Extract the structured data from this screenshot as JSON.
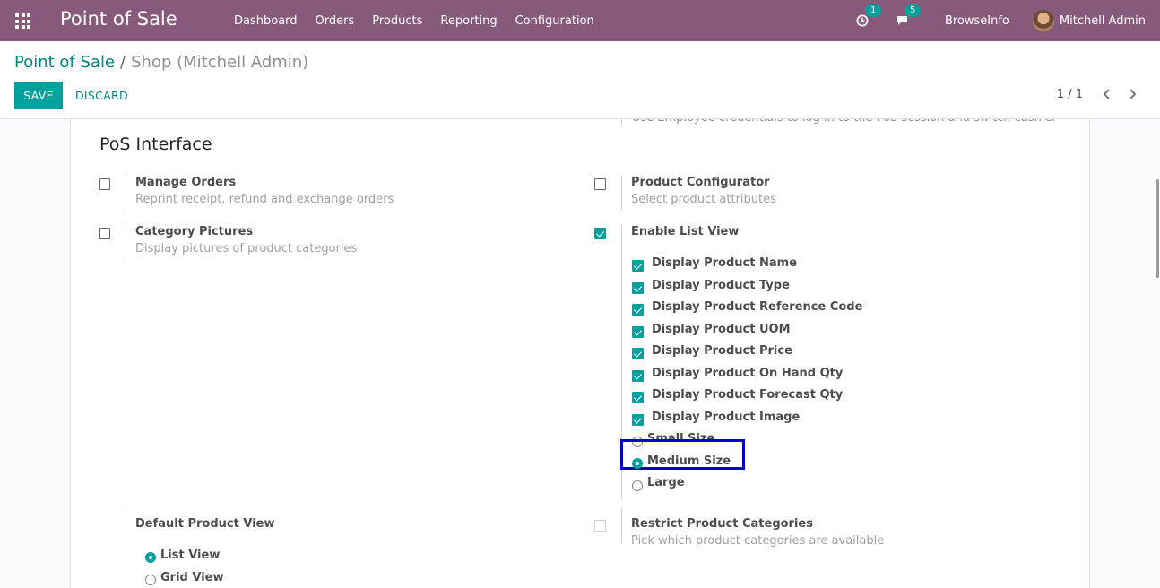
{
  "navbar": {
    "brand": "Point of Sale",
    "menu": [
      "Dashboard",
      "Orders",
      "Products",
      "Reporting",
      "Configuration"
    ],
    "activity_count": "1",
    "messages_count": "5",
    "company": "BrowseInfo",
    "user": "Mitchell Admin"
  },
  "breadcrumb": {
    "parent": "Point of Sale",
    "separator": "/",
    "current": "Shop (Mitchell Admin)"
  },
  "actions": {
    "save": "SAVE",
    "discard": "DISCARD"
  },
  "pager": {
    "text": "1 / 1"
  },
  "sheet": {
    "cut_text": "Use Employee credentials to log in to the PoS session and switch cashier",
    "section_title": "PoS Interface",
    "manage_orders": {
      "label": "Manage Orders",
      "desc": "Reprint receipt, refund and exchange orders",
      "checked": false
    },
    "product_configurator": {
      "label": "Product Configurator",
      "desc": "Select product attributes",
      "checked": false
    },
    "category_pictures": {
      "label": "Category Pictures",
      "desc": "Display pictures of product categories",
      "checked": false
    },
    "enable_list_view": {
      "label": "Enable List View",
      "checked": true
    },
    "list_options": [
      {
        "label": "Display Product Name",
        "checked": true
      },
      {
        "label": "Display Product Type",
        "checked": true
      },
      {
        "label": "Display Product Reference Code",
        "checked": true
      },
      {
        "label": "Display Product UOM",
        "checked": true
      },
      {
        "label": "Display Product Price",
        "checked": true
      },
      {
        "label": "Display Product On Hand Qty",
        "checked": true
      },
      {
        "label": "Display Product Forecast Qty",
        "checked": true
      },
      {
        "label": "Display Product Image",
        "checked": true
      }
    ],
    "image_sizes": [
      {
        "label": "Small Size",
        "selected": false
      },
      {
        "label": "Medium Size",
        "selected": true
      },
      {
        "label": "Large",
        "selected": false
      }
    ],
    "default_product_view": {
      "label": "Default Product View",
      "options": [
        {
          "label": "List View",
          "selected": true
        },
        {
          "label": "Grid View",
          "selected": false
        }
      ]
    },
    "restrict_categories": {
      "label": "Restrict Product Categories",
      "desc": "Pick which product categories are available",
      "checked": false
    }
  },
  "colors": {
    "navbar": "#875a7b",
    "primary": "#00a09d",
    "link": "#00827f",
    "highlight": "#0000cc"
  }
}
